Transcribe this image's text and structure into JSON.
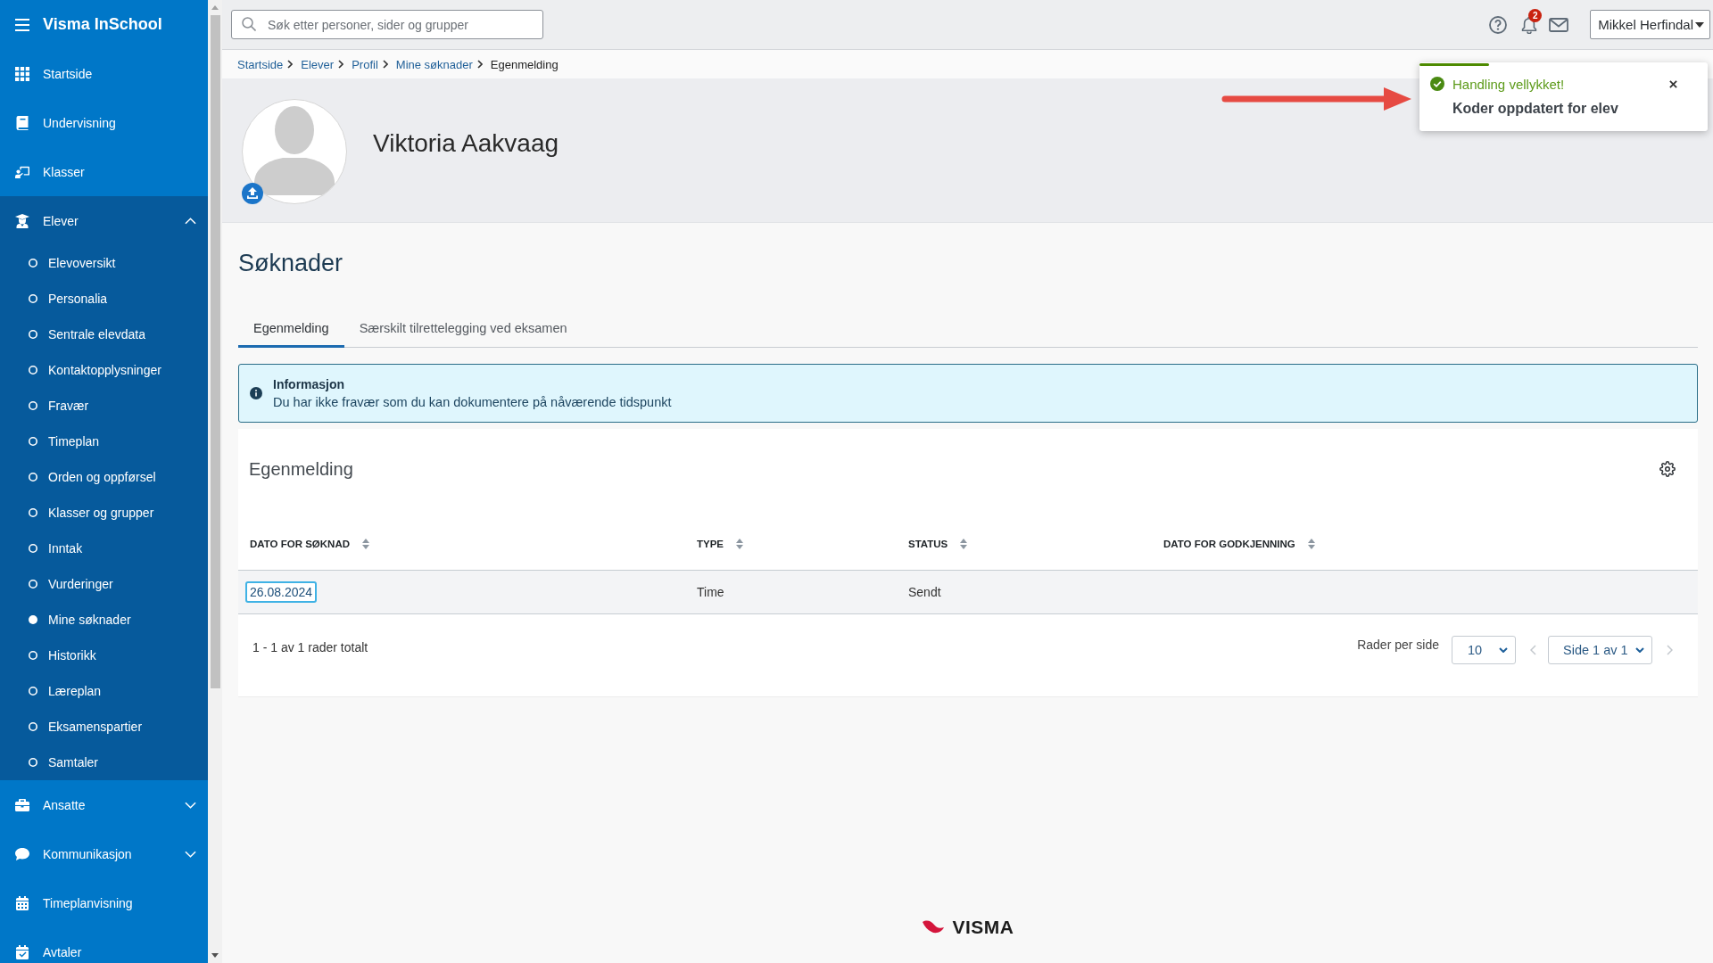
{
  "sidebar": {
    "title": "Visma InSchool",
    "items": [
      {
        "label": "Startside"
      },
      {
        "label": "Undervisning"
      },
      {
        "label": "Klasser"
      },
      {
        "label": "Elever",
        "expanded": true,
        "children": [
          {
            "label": "Elevoversikt",
            "selected": false
          },
          {
            "label": "Personalia",
            "selected": false
          },
          {
            "label": "Sentrale elevdata",
            "selected": false
          },
          {
            "label": "Kontaktopplysninger",
            "selected": false
          },
          {
            "label": "Fravær",
            "selected": false
          },
          {
            "label": "Timeplan",
            "selected": false
          },
          {
            "label": "Orden og oppførsel",
            "selected": false
          },
          {
            "label": "Klasser og grupper",
            "selected": false
          },
          {
            "label": "Inntak",
            "selected": false
          },
          {
            "label": "Vurderinger",
            "selected": false
          },
          {
            "label": "Mine søknader",
            "selected": true
          },
          {
            "label": "Historikk",
            "selected": false
          },
          {
            "label": "Læreplan",
            "selected": false
          },
          {
            "label": "Eksamenspartier",
            "selected": false
          },
          {
            "label": "Samtaler",
            "selected": false
          }
        ]
      },
      {
        "label": "Ansatte",
        "expanded": false
      },
      {
        "label": "Kommunikasjon",
        "expanded": false
      },
      {
        "label": "Timeplanvisning"
      },
      {
        "label": "Avtaler"
      }
    ]
  },
  "topbar": {
    "search": {
      "placeholder": "Søk etter personer, sider og grupper"
    },
    "notifications": {
      "count": "2"
    },
    "user": {
      "name": "Mikkel Herfindal"
    }
  },
  "breadcrumb": [
    {
      "label": "Startside",
      "kind": "link"
    },
    {
      "label": "Elever",
      "kind": "link"
    },
    {
      "label": "Profil",
      "kind": "link"
    },
    {
      "label": "Mine søknader",
      "kind": "link"
    },
    {
      "label": "Egenmelding",
      "kind": "current"
    }
  ],
  "profile": {
    "name": "Viktoria Aakvaag"
  },
  "page": {
    "title": "Søknader",
    "tabs": [
      {
        "label": "Egenmelding",
        "selected": true
      },
      {
        "label": "Særskilt tilrettelegging ved eksamen",
        "selected": false
      }
    ],
    "alert": {
      "title": "Informasjon",
      "text": "Du har ikke fravær som du kan dokumentere på nåværende tidspunkt"
    }
  },
  "table": {
    "title": "Egenmelding",
    "columns": [
      "DATO FOR SØKNAD",
      "TYPE",
      "STATUS",
      "DATO FOR GODKJENNING"
    ],
    "rows": [
      {
        "cells": [
          {
            "text": "26.08.2024",
            "kind": "link",
            "focused": true
          },
          {
            "text": "Time",
            "kind": "text",
            "focused": false
          },
          {
            "text": "Sendt",
            "kind": "text",
            "focused": false
          }
        ]
      }
    ]
  },
  "pagination": {
    "summary": "1 - 1 av 1 rader totalt",
    "rows_per_page_label": "Rader per side",
    "rows_per_page": "10",
    "page": "Side 1 av 1",
    "previous_page": {
      "disabled": true
    },
    "next_page": {
      "disabled": true
    }
  },
  "toast": {
    "title": "Handling vellykket!",
    "message": "Koder oppdatert for elev",
    "level": 0.24
  },
  "footer": {
    "logo": "VISMA"
  }
}
